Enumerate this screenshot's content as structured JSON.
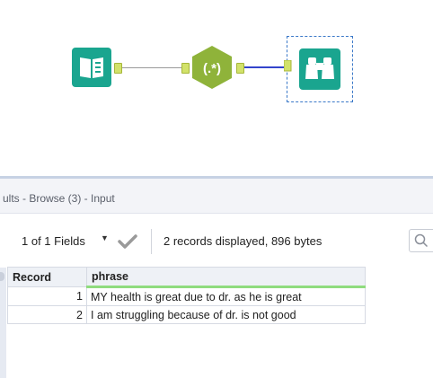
{
  "canvas": {
    "tools": [
      {
        "name": "input-data-tool",
        "icon": "book-icon",
        "color": "#1aa58f"
      },
      {
        "name": "regex-tool",
        "icon": "regex-icon",
        "label": "(.*)",
        "color": "#8fb33a"
      },
      {
        "name": "browse-tool",
        "icon": "binoculars-icon",
        "color": "#1aa58f",
        "selected": true
      }
    ]
  },
  "results": {
    "title": "ults - Browse (3) - Input",
    "toolbar": {
      "fields_label": "1 of 1 Fields",
      "records_info": "2 records displayed, 896 bytes"
    },
    "columns": [
      "Record",
      "phrase"
    ],
    "rows": [
      {
        "record": "1",
        "phrase": "MY health is great due to dr. as he is great"
      },
      {
        "record": "2",
        "phrase": "I am struggling because of dr. is not good"
      }
    ]
  },
  "colors": {
    "accent_teal": "#1aa58f",
    "regex_green": "#8fb33a",
    "anchor_yellow": "#d2e26a",
    "connection_blue": "#3344cc",
    "field_underline": "#8fdc7e"
  }
}
